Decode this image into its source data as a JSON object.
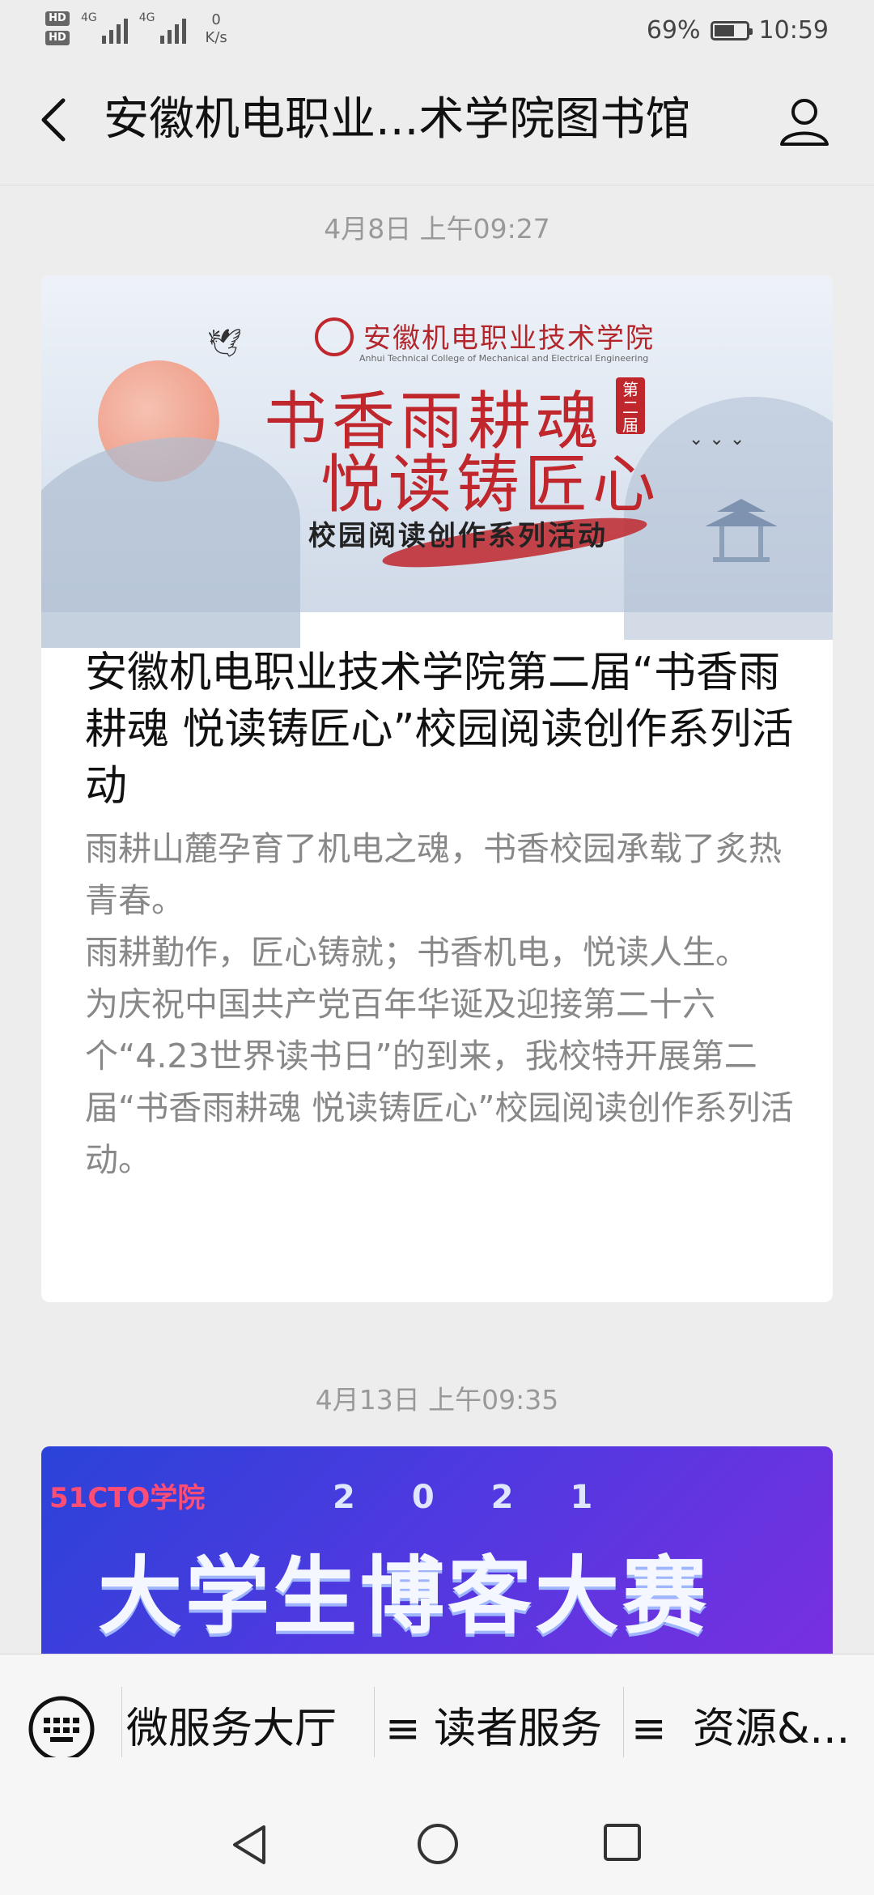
{
  "status_bar": {
    "hd1": "HD",
    "hd2": "HD",
    "signal1_label": "4G",
    "signal2_label": "4G",
    "net_speed_value": "0",
    "net_speed_unit": "K/s",
    "battery_percent": "69%",
    "battery_level": 0.69,
    "time": "10:59"
  },
  "navbar": {
    "title": "安徽机电职业...术学院图书馆",
    "back_icon": "chevron-left-icon",
    "profile_icon": "person-icon"
  },
  "feed": [
    {
      "timestamp": "4月8日 上午09:27",
      "banner": {
        "school_name": "安徽机电职业技术学院",
        "school_name_en": "Anhui Technical College of Mechanical and Electrical Engineering",
        "headline_1": "书香雨耕魂",
        "headline_2": "悦读铸匠心",
        "edition_badge": "第二届",
        "subtitle": "校园阅读创作系列活动"
      },
      "title": "安徽机电职业技术学院第二届“书香雨耕魂 悦读铸匠心”校园阅读创作系列活动",
      "description": "雨耕山麓孕育了机电之魂，书香校园承载了炙热青春。\n雨耕勤作，匠心铸就；书香机电，悦读人生。\n为庆祝中国共产党百年华诞及迎接第二十六个“4.23世界读书日”的到来，我校特开展第二届“书香雨耕魂 悦读铸匠心”校园阅读创作系列活动。"
    },
    {
      "timestamp": "4月13日 上午09:35",
      "banner": {
        "brand": "51CTO学院",
        "year": "2021",
        "headline": "大学生博客大赛"
      }
    }
  ],
  "bottom_menu": {
    "keyboard_icon": "keyboard-icon",
    "items": [
      {
        "label": "微服务大厅"
      },
      {
        "label": "≡ 读者服务"
      },
      {
        "label": "≡"
      },
      {
        "label": "资源&..."
      }
    ]
  },
  "system_nav": {
    "back": "triangle-back-icon",
    "home": "circle-home-icon",
    "recents": "square-recents-icon"
  }
}
